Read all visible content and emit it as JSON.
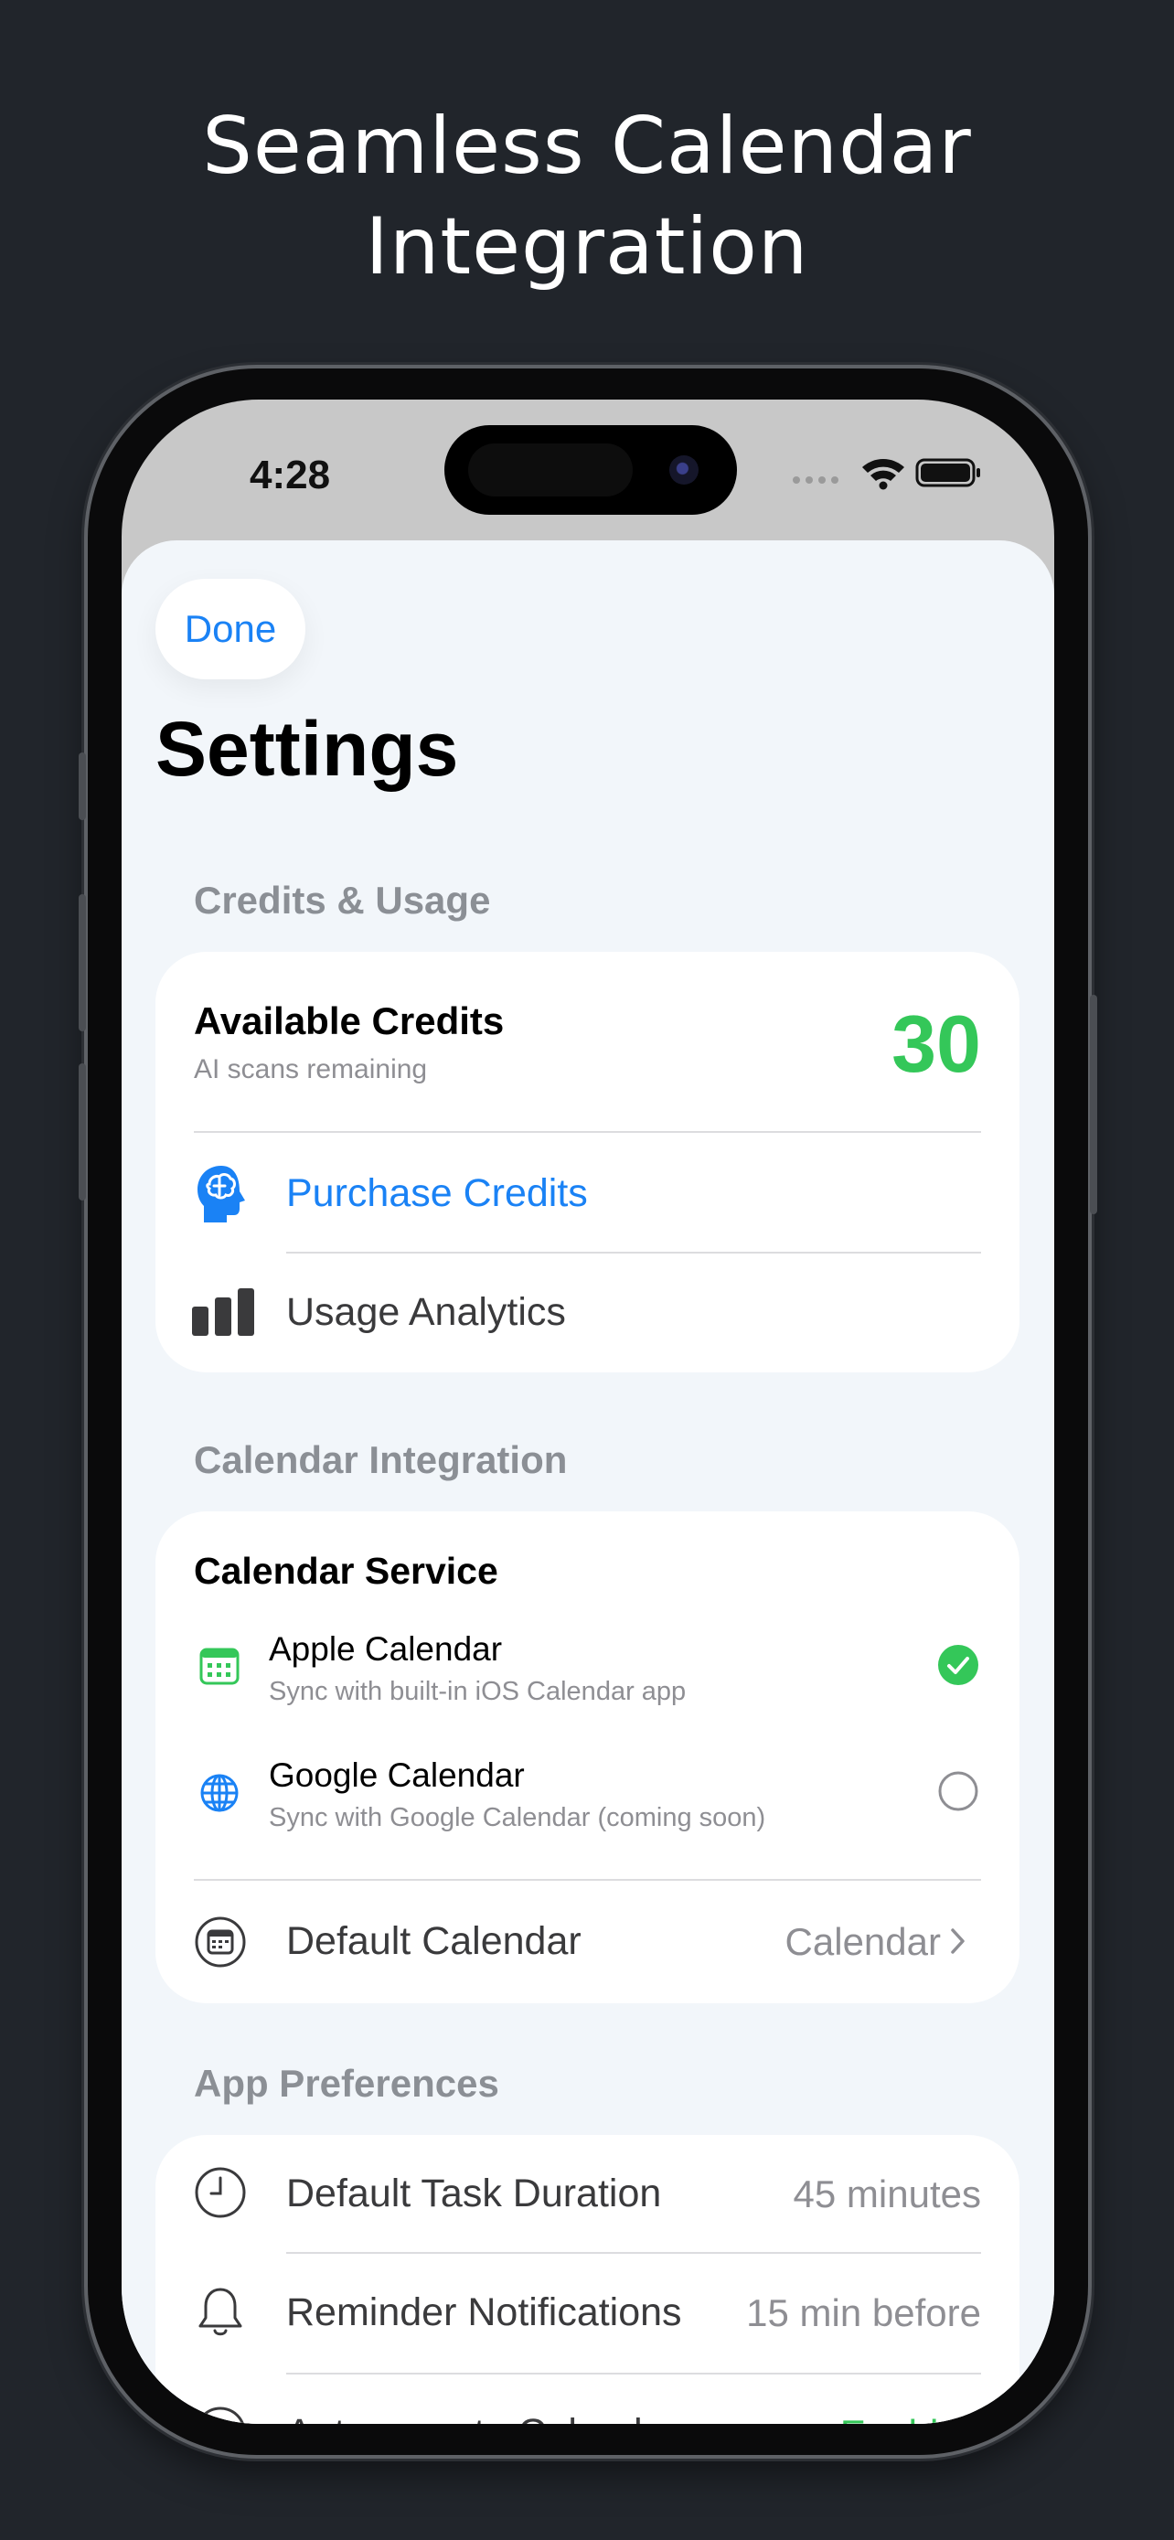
{
  "headline": {
    "line1": "Seamless Calendar",
    "line2": "Integration"
  },
  "status_bar": {
    "time": "4:28"
  },
  "nav": {
    "done_label": "Done"
  },
  "title": "Settings",
  "credits": {
    "header": "Credits & Usage",
    "available_label": "Available Credits",
    "available_sub": "AI scans remaining",
    "available_value": "30",
    "purchase_label": "Purchase Credits",
    "analytics_label": "Usage Analytics"
  },
  "calendar": {
    "header": "Calendar Integration",
    "service_title": "Calendar Service",
    "options": [
      {
        "name": "Apple Calendar",
        "desc": "Sync with built-in iOS Calendar app",
        "selected": true
      },
      {
        "name": "Google Calendar",
        "desc": "Sync with Google Calendar (coming soon)",
        "selected": false
      }
    ],
    "default_label": "Default Calendar",
    "default_value": "Calendar"
  },
  "preferences": {
    "header": "App Preferences",
    "rows": [
      {
        "label": "Default Task Duration",
        "value": "45 minutes"
      },
      {
        "label": "Reminder Notifications",
        "value": "15 min before"
      },
      {
        "label": "Auto-save to Calendar",
        "value": "Enabled"
      }
    ]
  },
  "colors": {
    "accent": "#1a82f5",
    "success": "#34c759",
    "background": "#21252b"
  }
}
